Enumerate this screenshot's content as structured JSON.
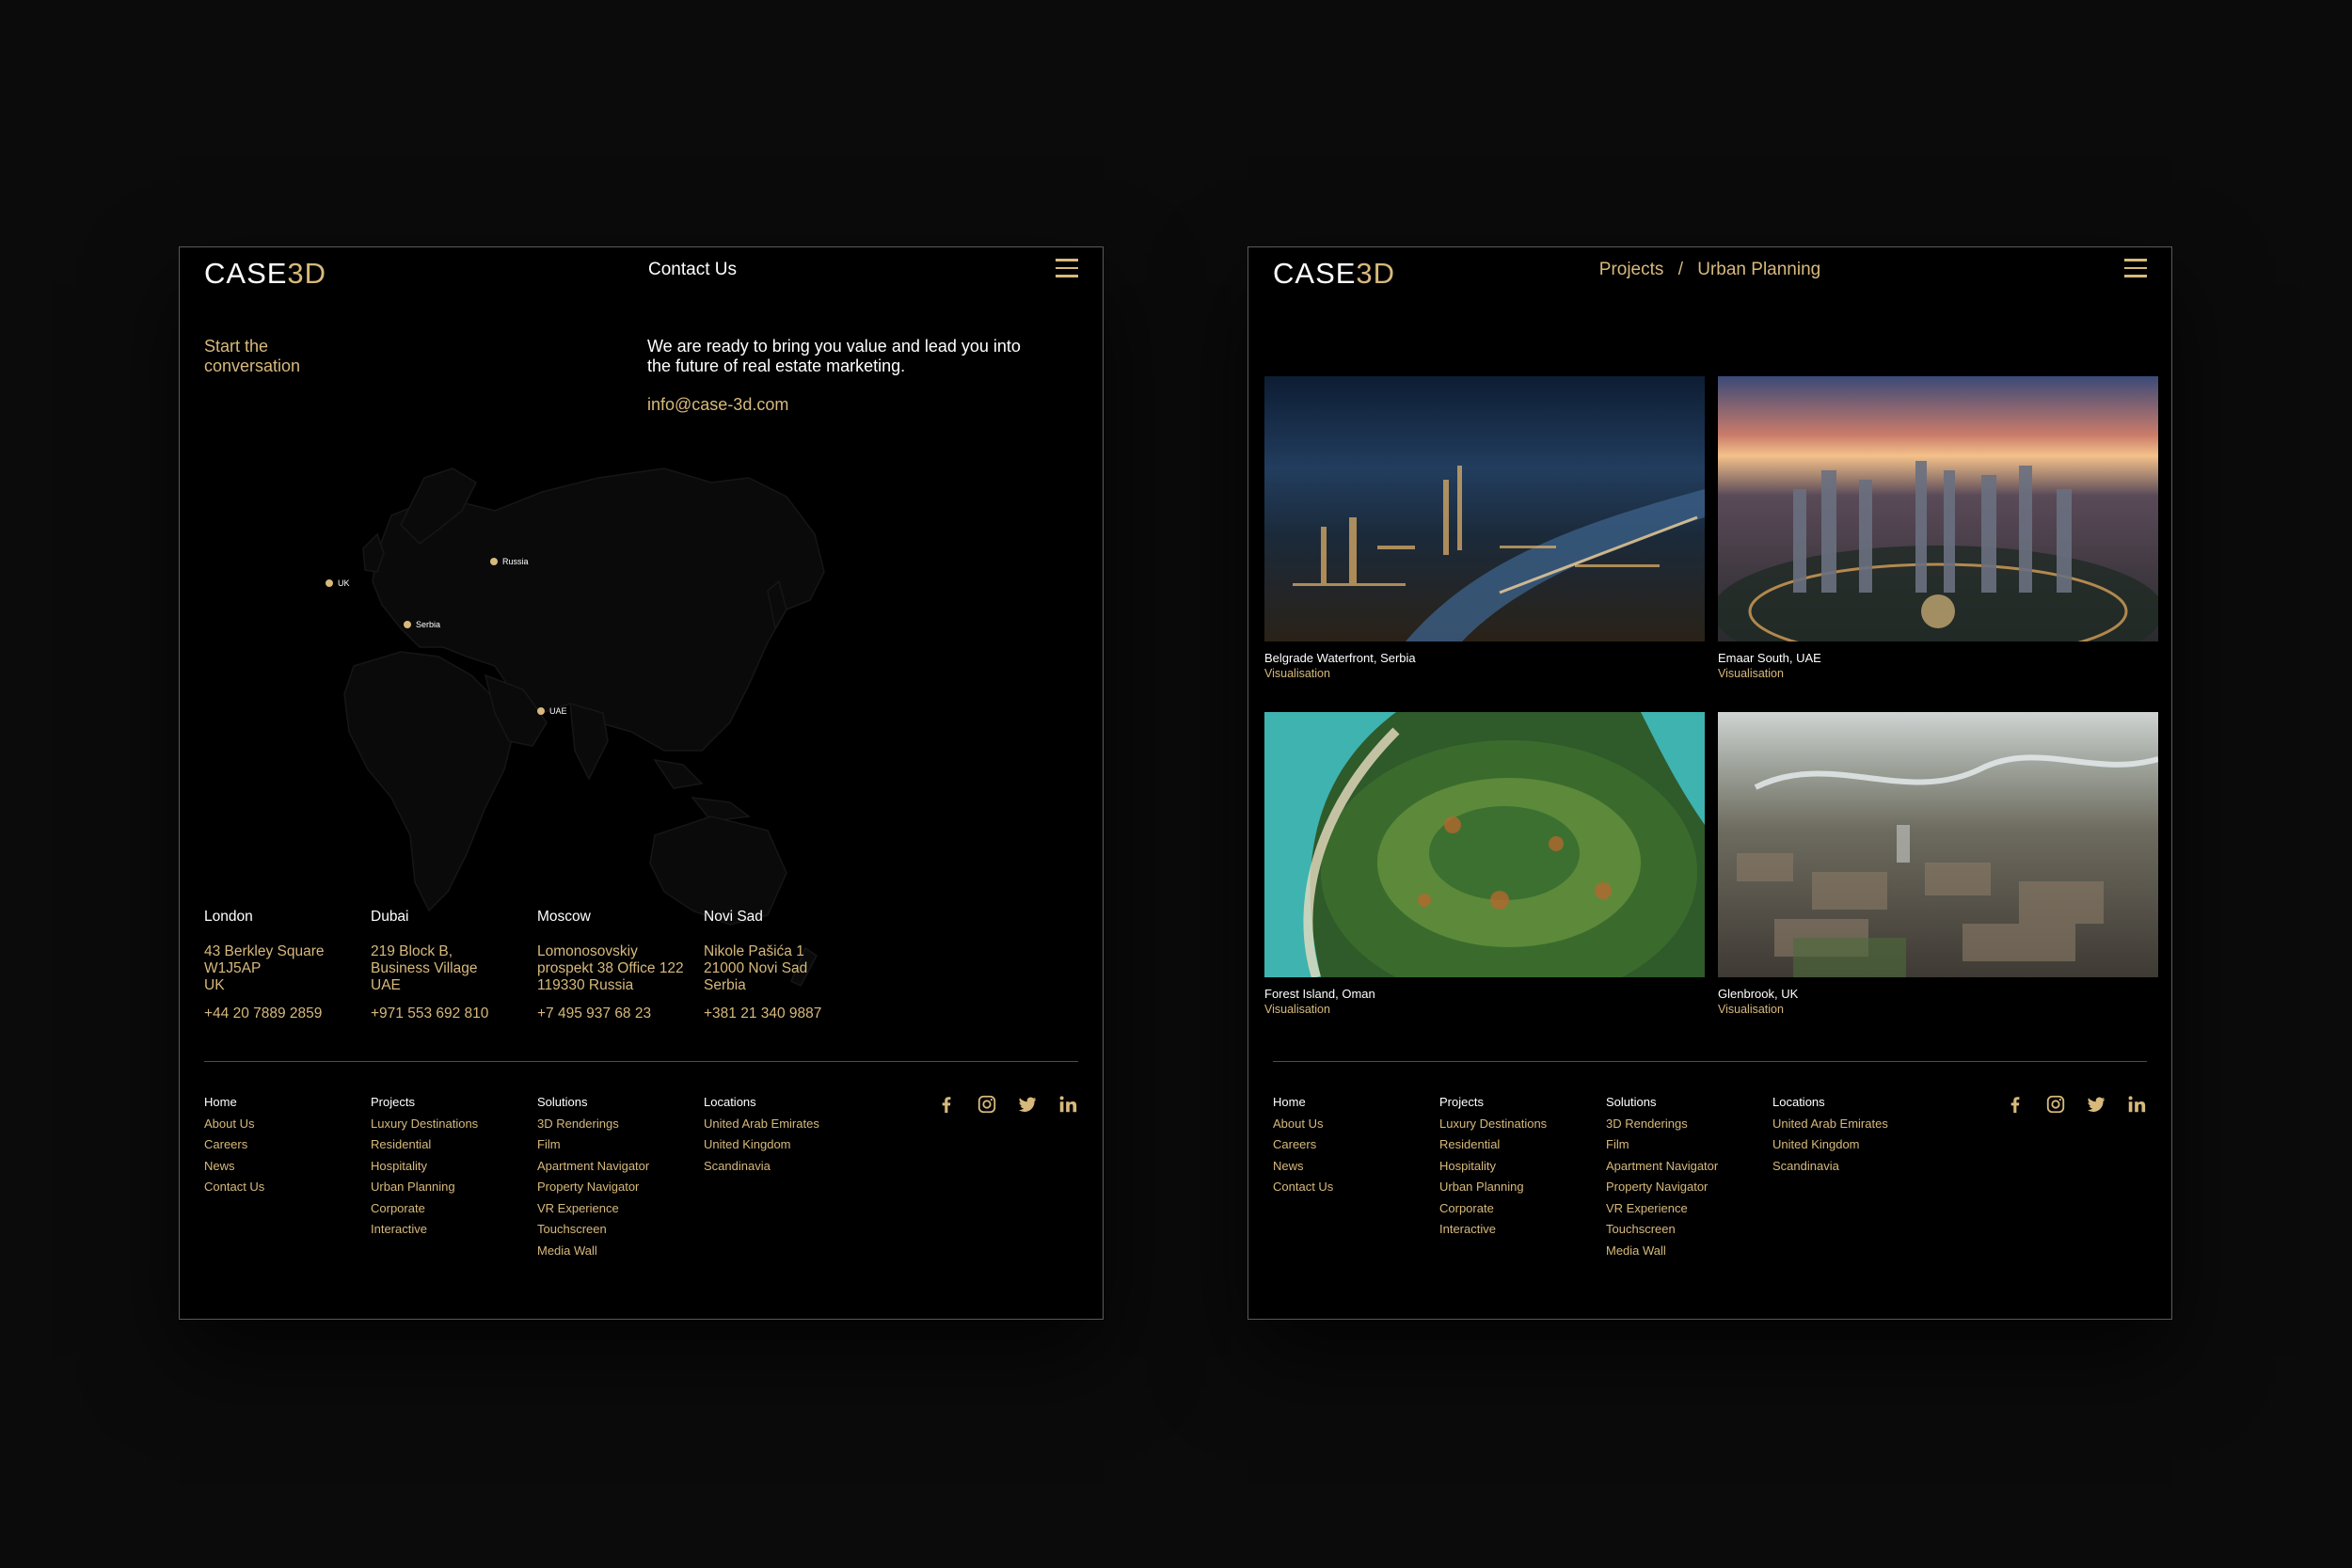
{
  "colors": {
    "accent": "#d7b97c",
    "background": "#000000",
    "backdrop": "#0b0b0c",
    "text": "#ffffff"
  },
  "logo": {
    "text_main": "CASE",
    "text_accent": "3D"
  },
  "contact_page": {
    "title": "Contact Us",
    "tagline": "Start the conversation",
    "intro": "We are ready to bring you value and lead you into the future of real estate marketing.",
    "email": "info@case-3d.com",
    "map_markers": [
      "UK",
      "Russia",
      "Serbia",
      "UAE"
    ],
    "offices": [
      {
        "city": "London",
        "address": [
          "43 Berkley Square",
          "W1J5AP",
          "UK"
        ],
        "phone": "+44 20 7889 2859"
      },
      {
        "city": "Dubai",
        "address": [
          "219 Block B,",
          "Business Village",
          "UAE"
        ],
        "phone": "+971 553 692 810"
      },
      {
        "city": "Moscow",
        "address": [
          "Lomonosovskiy",
          "prospekt 38 Office 122",
          "119330 Russia"
        ],
        "phone": "+7 495 937 68 23"
      },
      {
        "city": "Novi Sad",
        "address": [
          "Nikole Pašića 1",
          "21000 Novi Sad",
          "Serbia"
        ],
        "phone": "+381 21 340 9887"
      }
    ]
  },
  "projects_page": {
    "breadcrumb": {
      "parent": "Projects",
      "separator": "/",
      "current": "Urban Planning"
    },
    "projects": [
      {
        "name": "Belgrade Waterfront, Serbia",
        "type": "Visualisation"
      },
      {
        "name": "Emaar South, UAE",
        "type": "Visualisation"
      },
      {
        "name": "Forest Island, Oman",
        "type": "Visualisation"
      },
      {
        "name": "Glenbrook, UK",
        "type": "Visualisation"
      }
    ]
  },
  "footer": {
    "columns": [
      {
        "heading": "Home",
        "links": [
          "About Us",
          "Careers",
          "News",
          "Contact Us"
        ]
      },
      {
        "heading": "Projects",
        "links": [
          "Luxury Destinations",
          "Residential",
          "Hospitality",
          "Urban Planning",
          "Corporate",
          "Interactive"
        ]
      },
      {
        "heading": "Solutions",
        "links": [
          "3D Renderings",
          "Film",
          "Apartment Navigator",
          "Property Navigator",
          "VR Experience",
          "Touchscreen",
          "Media Wall"
        ]
      },
      {
        "heading": "Locations",
        "links": [
          "United Arab Emirates",
          "United Kingdom",
          "Scandinavia"
        ]
      }
    ],
    "socials": [
      "facebook-icon",
      "instagram-icon",
      "twitter-icon",
      "linkedin-icon"
    ]
  }
}
